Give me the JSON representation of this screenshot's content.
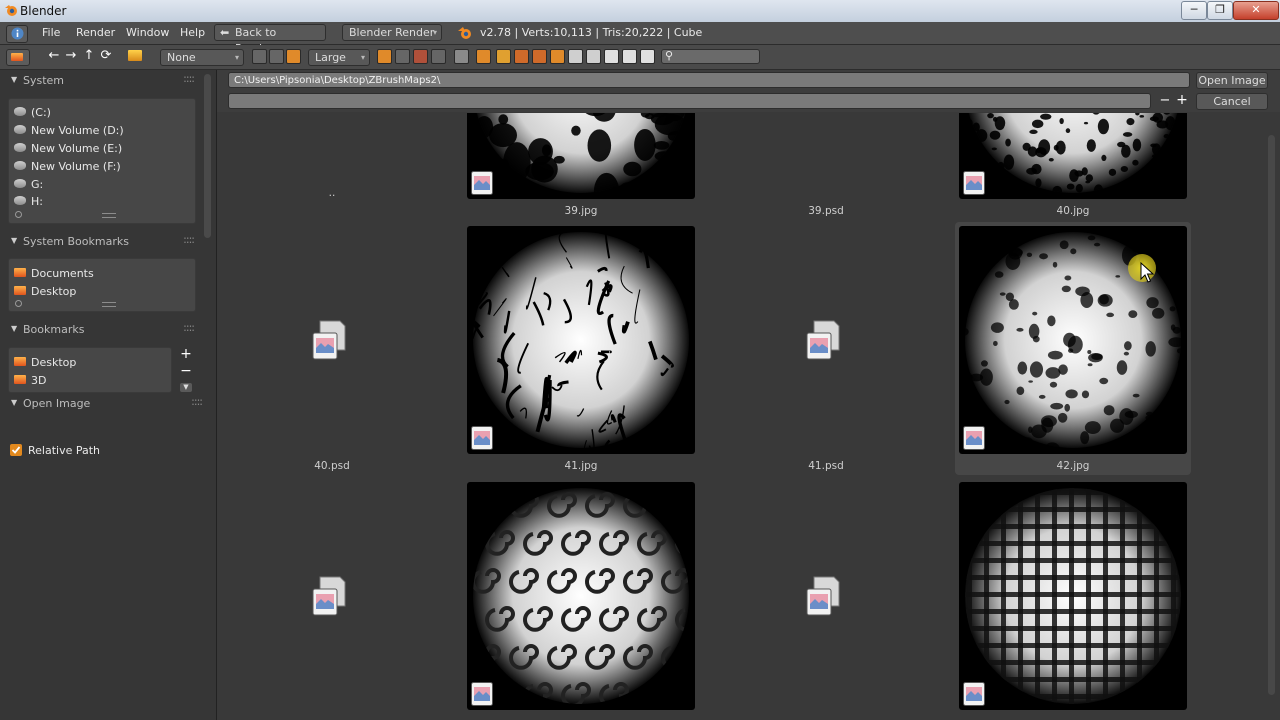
{
  "window": {
    "title": "Blender",
    "controls": {
      "minimize": "─",
      "maximize": "❐",
      "close": "✕"
    }
  },
  "info_header": {
    "menus": [
      "File",
      "Render",
      "Window",
      "Help"
    ],
    "back_button": "Back to Previous",
    "render_engine": "Blender Render",
    "stats": "v2.78 | Verts:10,113 | Tris:20,222 | Cube"
  },
  "file_header": {
    "filter_dropdown": "None",
    "display_size_dropdown": "Large",
    "search_placeholder": ""
  },
  "sidebar": {
    "system": {
      "title": "System",
      "items": [
        {
          "label": "(C:)",
          "icon": "drive-icon"
        },
        {
          "label": "New Volume (D:)",
          "icon": "drive-icon"
        },
        {
          "label": "New Volume (E:)",
          "icon": "drive-icon"
        },
        {
          "label": "New Volume (F:)",
          "icon": "drive-icon"
        },
        {
          "label": "G:",
          "icon": "drive-icon"
        },
        {
          "label": "H:",
          "icon": "drive-icon"
        }
      ]
    },
    "system_bookmarks": {
      "title": "System Bookmarks",
      "items": [
        {
          "label": "Documents",
          "icon": "folder-icon"
        },
        {
          "label": "Desktop",
          "icon": "folder-icon"
        }
      ]
    },
    "bookmarks": {
      "title": "Bookmarks",
      "items": [
        {
          "label": "Desktop",
          "icon": "folder-icon"
        },
        {
          "label": "3D",
          "icon": "folder-icon"
        }
      ],
      "add": "+",
      "remove": "−"
    },
    "open_image": {
      "title": "Open Image",
      "relative_path_label": "Relative Path",
      "relative_path_checked": true
    }
  },
  "path_bar": {
    "directory": "C:\\Users\\Pipsonia\\Desktop\\ZBrushMaps2\\",
    "filename": "",
    "open_button": "Open Image",
    "cancel_button": "Cancel",
    "decrement": "−",
    "increment": "+"
  },
  "files": [
    {
      "name": "..",
      "kind": "parent"
    },
    {
      "name": "39.jpg",
      "kind": "image",
      "texture": "splotch"
    },
    {
      "name": "39.psd",
      "kind": "psd"
    },
    {
      "name": "40.jpg",
      "kind": "image",
      "texture": "speckle"
    },
    {
      "name": "40.psd",
      "kind": "psd"
    },
    {
      "name": "41.jpg",
      "kind": "image",
      "texture": "cracks"
    },
    {
      "name": "41.psd",
      "kind": "psd"
    },
    {
      "name": "42.jpg",
      "kind": "image",
      "texture": "cloud",
      "highlighted": true
    },
    {
      "name": "",
      "kind": "psd"
    },
    {
      "name": "",
      "kind": "image",
      "texture": "swirl"
    },
    {
      "name": "",
      "kind": "psd"
    },
    {
      "name": "",
      "kind": "image",
      "texture": "weave"
    }
  ]
}
